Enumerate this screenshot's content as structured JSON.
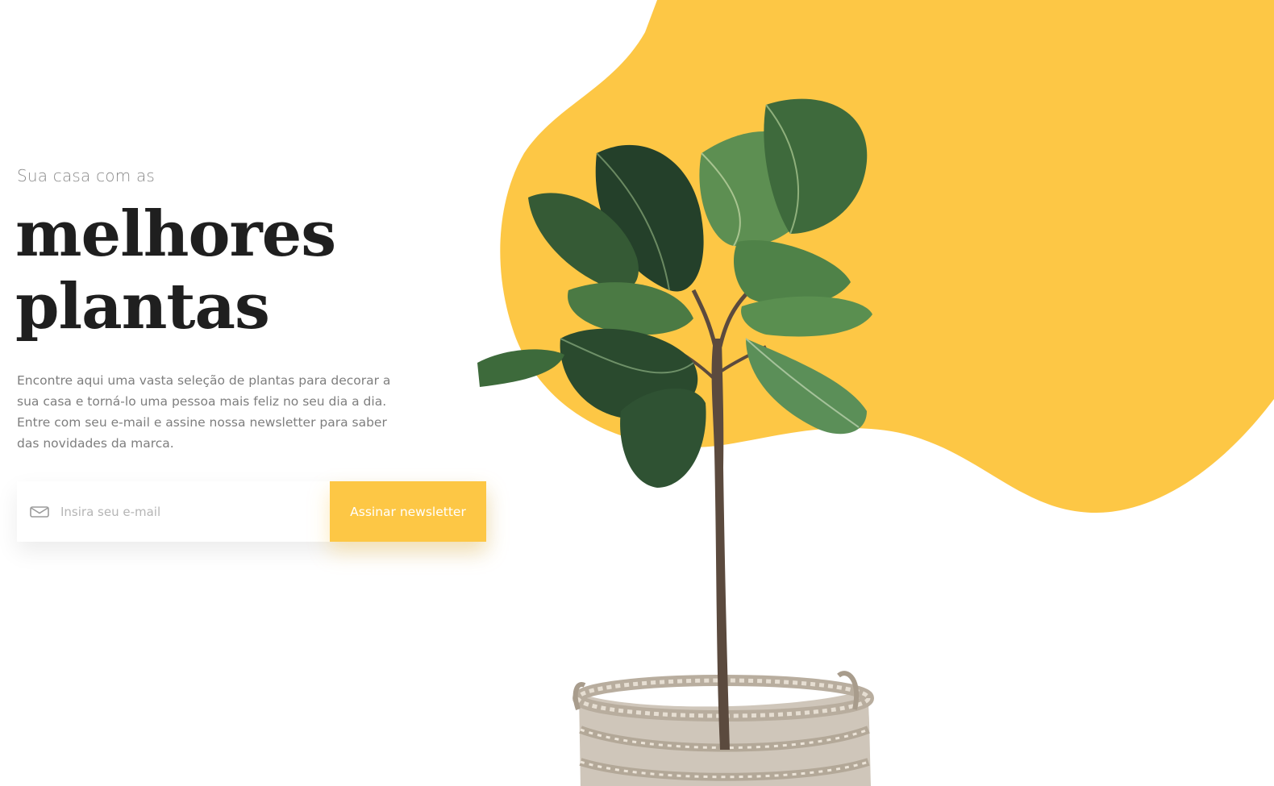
{
  "hero": {
    "subtitle": "Sua casa com as",
    "headline_line1": "melhores",
    "headline_line2": "plantas",
    "description": "Encontre aqui uma vasta seleção de plantas para decorar a sua casa e torná-lo uma pessoa mais feliz no seu dia a dia. Entre com seu e-mail e assine nossa newsletter para saber das novidades da marca."
  },
  "newsletter": {
    "email_placeholder": "Insira seu e-mail",
    "email_value": "",
    "button_label": "Assinar newsletter",
    "icon": "mail-icon"
  },
  "colors": {
    "accent": "#fdc745",
    "heading": "#1f1f1f",
    "body_text": "#7e7e7e"
  }
}
